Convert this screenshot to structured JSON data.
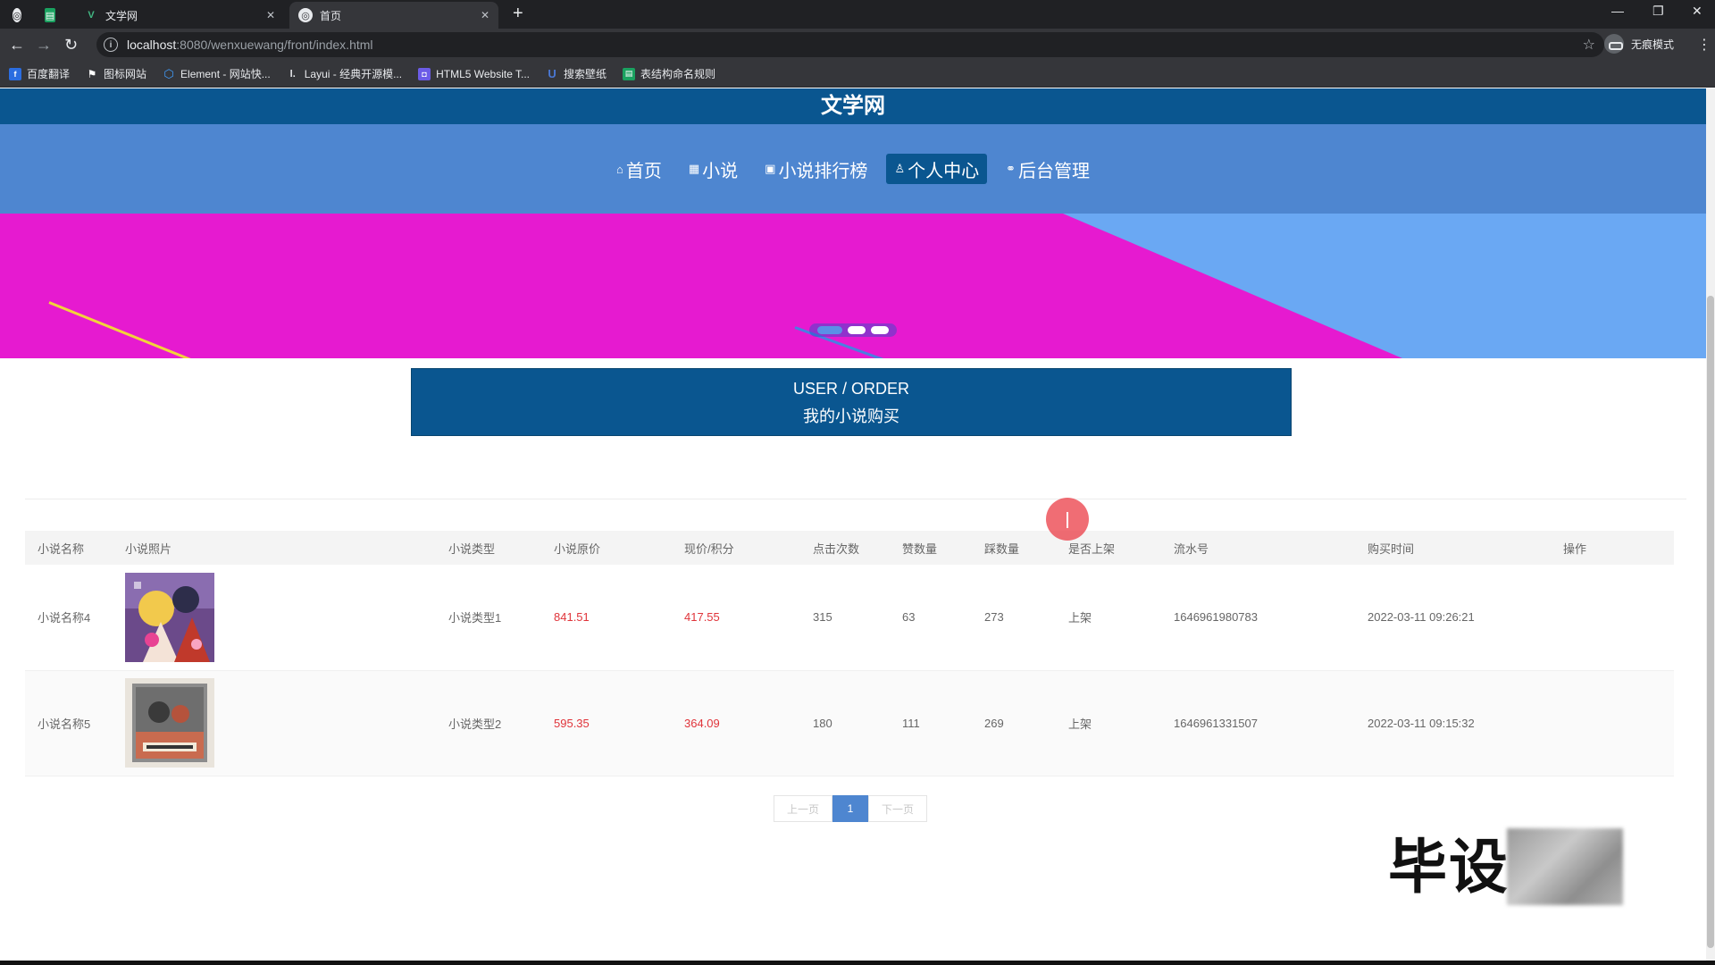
{
  "browser": {
    "tabs": [
      {
        "title": "文学网",
        "active": false
      },
      {
        "title": "首页",
        "active": true
      }
    ],
    "url_host": "localhost",
    "url_path": ":8080/wenxuewang/front/index.html",
    "incognito_label": "无痕模式",
    "bookmarks": [
      {
        "label": "百度翻译",
        "icon": "translate-icon",
        "color": "#2b6de0"
      },
      {
        "label": "图标网站",
        "icon": "flag-icon",
        "color": "#ffffff"
      },
      {
        "label": "Element - 网站快...",
        "icon": "element-icon",
        "color": "#409eff"
      },
      {
        "label": "Layui - 经典开源模...",
        "icon": "layui-icon",
        "color": "#e8eaed"
      },
      {
        "label": "HTML5 Website T...",
        "icon": "html5-icon",
        "color": "#6c5ce7"
      },
      {
        "label": "搜索壁纸",
        "icon": "wallpaper-icon",
        "color": "#4a78d4"
      },
      {
        "label": "表结构命名规则",
        "icon": "sheet-icon",
        "color": "#1aa260"
      }
    ]
  },
  "site": {
    "title": "文学网",
    "nav": [
      {
        "label": "首页",
        "icon": "home-icon",
        "glyph": "⌂",
        "active": false
      },
      {
        "label": "小说",
        "icon": "book-icon",
        "glyph": "▦",
        "active": false
      },
      {
        "label": "小说排行榜",
        "icon": "gift-icon",
        "glyph": "▣",
        "active": false
      },
      {
        "label": "个人中心",
        "icon": "user-icon",
        "glyph": "♙",
        "active": true
      },
      {
        "label": "后台管理",
        "icon": "link-icon",
        "glyph": "⚭",
        "active": false
      }
    ],
    "banner_slides": 3,
    "banner_active": 0
  },
  "section": {
    "en": "USER / ORDER",
    "zh": "我的小说购买"
  },
  "orders": {
    "headers": [
      "小说名称",
      "小说照片",
      "小说类型",
      "小说原价",
      "现价/积分",
      "点击次数",
      "赞数量",
      "踩数量",
      "是否上架",
      "流水号",
      "购买时间",
      "操作"
    ],
    "rows": [
      {
        "name": "小说名称4",
        "type": "小说类型1",
        "original_price": "841.51",
        "current_price": "417.55",
        "clicks": "315",
        "likes": "63",
        "dislikes": "273",
        "on_shelf": "上架",
        "serial": "1646961980783",
        "time": "2022-03-11 09:26:21"
      },
      {
        "name": "小说名称5",
        "type": "小说类型2",
        "original_price": "595.35",
        "current_price": "364.09",
        "clicks": "180",
        "likes": "111",
        "dislikes": "269",
        "on_shelf": "上架",
        "serial": "1646961331507",
        "time": "2022-03-11 09:15:32"
      }
    ]
  },
  "pager": {
    "prev": "上一页",
    "current": "1",
    "next": "下一页"
  },
  "watermark": {
    "text": "毕设"
  },
  "colors": {
    "header": "#0a5690",
    "nav": "#4e86d0",
    "banner_pink": "#e61ad0",
    "banner_blue": "#6aa8f3",
    "price_red": "#e0343a"
  }
}
